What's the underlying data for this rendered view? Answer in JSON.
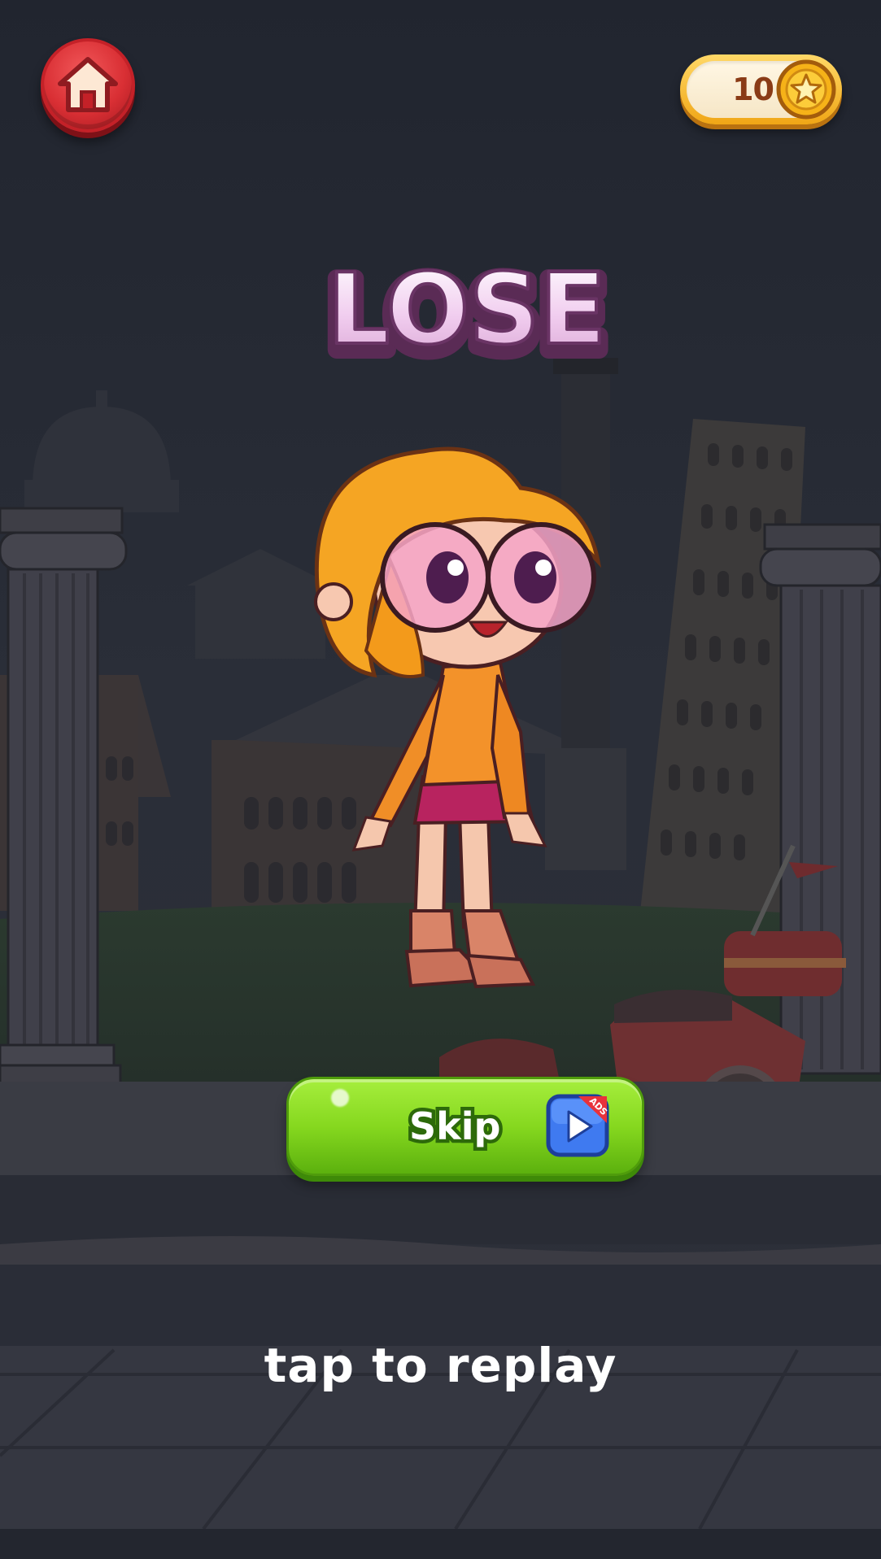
{
  "hud": {
    "home_icon": "home-icon",
    "coins": "10",
    "coin_icon": "star-coin-icon"
  },
  "result": {
    "title": "LOSE"
  },
  "actions": {
    "skip_label": "Skip",
    "skip_icon": "video-ad-play-icon",
    "ads_tag": "ADS",
    "replay_hint": "tap to replay"
  },
  "colors": {
    "home_red": "#d92f34",
    "coin_gold": "#f0a616",
    "title_pink": "#ecc8ea",
    "skip_green": "#86d81f",
    "background": "#242936"
  }
}
